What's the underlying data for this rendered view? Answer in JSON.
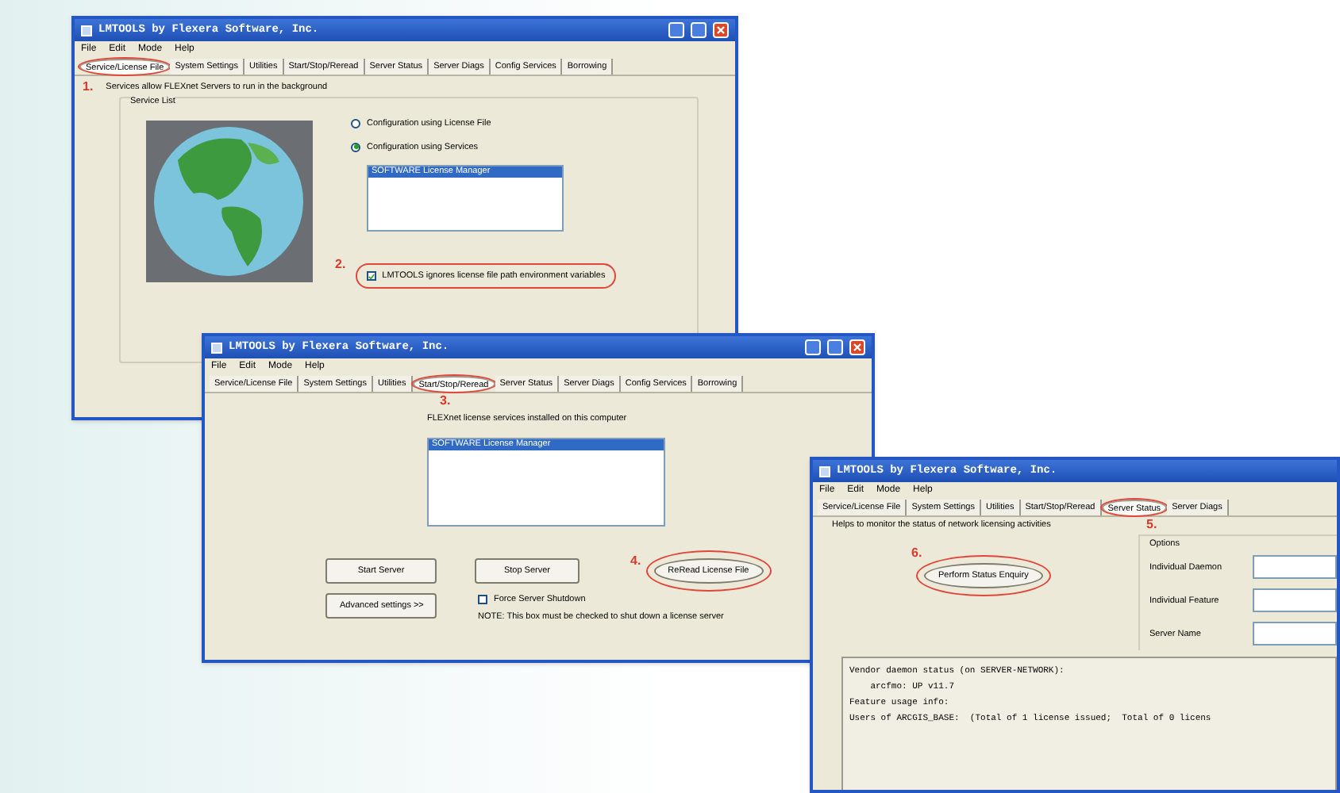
{
  "windows": [
    {
      "kind": "service_config",
      "title": "LMTOOLS by Flexera Software, Inc.",
      "menu": [
        "File",
        "Edit",
        "Mode",
        "Help"
      ],
      "tabs": [
        {
          "label": "Service/License File",
          "selected": true,
          "circled": true
        },
        {
          "label": "System Settings",
          "selected": false,
          "circled": false
        },
        {
          "label": "Utilities",
          "selected": false,
          "circled": false
        },
        {
          "label": "Start/Stop/Reread",
          "selected": false,
          "circled": false
        },
        {
          "label": "Server Status",
          "selected": false,
          "circled": false
        },
        {
          "label": "Server Diags",
          "selected": false,
          "circled": false
        },
        {
          "label": "Config Services",
          "selected": false,
          "circled": false
        },
        {
          "label": "Borrowing",
          "selected": false,
          "circled": false
        }
      ],
      "tab_step": "1.",
      "description": "Services allow FLEXnet Servers to run in the background",
      "group_label": "Service List",
      "radios": [
        {
          "label": "Configuration using License File",
          "selected": false
        },
        {
          "label": "Configuration using Services",
          "selected": true
        }
      ],
      "list": [
        {
          "label": "SOFTWARE License Manager",
          "selected": true
        }
      ],
      "checkbox": {
        "step": "2.",
        "label": "LMTOOLS ignores license file path environment variables",
        "checked": true,
        "circled": true
      }
    },
    {
      "kind": "start_stop",
      "title": "LMTOOLS by Flexera Software, Inc.",
      "menu": [
        "File",
        "Edit",
        "Mode",
        "Help"
      ],
      "tabs": [
        {
          "label": "Service/License File",
          "selected": false,
          "circled": false
        },
        {
          "label": "System Settings",
          "selected": false,
          "circled": false
        },
        {
          "label": "Utilities",
          "selected": false,
          "circled": false
        },
        {
          "label": "Start/Stop/Reread",
          "selected": true,
          "circled": true
        },
        {
          "label": "Server Status",
          "selected": false,
          "circled": false
        },
        {
          "label": "Server Diags",
          "selected": false,
          "circled": false
        },
        {
          "label": "Config Services",
          "selected": false,
          "circled": false
        },
        {
          "label": "Borrowing",
          "selected": false,
          "circled": false
        }
      ],
      "tab_step": "3.",
      "description": "FLEXnet license services installed on this computer",
      "list": [
        {
          "label": "SOFTWARE License Manager",
          "selected": true
        }
      ],
      "buttons": [
        {
          "label": "Start Server",
          "circled": false
        },
        {
          "label": "Stop Server",
          "circled": false
        },
        {
          "label": "ReRead License File",
          "circled": true,
          "step": "4."
        },
        {
          "label": "Advanced settings >>",
          "circled": false
        }
      ],
      "checkbox": {
        "label": "Force Server Shutdown",
        "checked": false
      },
      "note": "NOTE:  This box must be checked to shut down a license server"
    },
    {
      "kind": "server_status",
      "title": "LMTOOLS by Flexera Software, Inc.",
      "menu": [
        "File",
        "Edit",
        "Mode",
        "Help"
      ],
      "tabs": [
        {
          "label": "Service/License File",
          "selected": false,
          "circled": false
        },
        {
          "label": "System Settings",
          "selected": false,
          "circled": false
        },
        {
          "label": "Utilities",
          "selected": false,
          "circled": false
        },
        {
          "label": "Start/Stop/Reread",
          "selected": false,
          "circled": false
        },
        {
          "label": "Server Status",
          "selected": true,
          "circled": true
        },
        {
          "label": "Server Diags",
          "selected": false,
          "circled": false
        }
      ],
      "tab_step": "5.",
      "description": "Helps to monitor the status of network licensing activities",
      "button": {
        "step": "6.",
        "label": "Perform Status Enquiry",
        "circled": true
      },
      "options_label": "Options",
      "fields": [
        {
          "label": "Individual Daemon"
        },
        {
          "label": "Individual Feature"
        },
        {
          "label": "Server Name"
        }
      ],
      "output": [
        "Vendor daemon status (on SERVER-NETWORK):",
        "    arcfmo: UP v11.7",
        "Feature usage info:",
        "Users of ARCGIS_BASE:  (Total of 1 license issued;  Total of 0 licens"
      ]
    }
  ]
}
